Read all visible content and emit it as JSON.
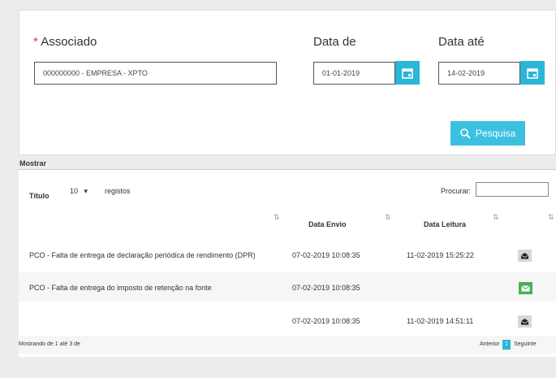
{
  "form": {
    "associado_label": "Associado",
    "required_mark": "*",
    "associado_value": "000000000 - EMPRESA - XPTO",
    "data_de_label": "Data de",
    "data_de_value": "01-01-2019",
    "data_ate_label": "Data até",
    "data_ate_value": "14-02-2019",
    "search_label": "Pesquisa"
  },
  "table": {
    "mostrar_label": "Mostrar",
    "titulo_label": "Título",
    "page_size": "10",
    "registos_label": "registos",
    "procurar_label": "Procurar:",
    "columns": [
      "Data Envio",
      "Data Leitura"
    ],
    "rows": [
      {
        "titulo": "PCO - Falta de entrega de declaração periódica de rendimento (DPR)",
        "envio": "07-02-2019 10:08:35",
        "leitura": "11-02-2019 15:25:22",
        "status": "read"
      },
      {
        "titulo": "PCO - Falta de entrega do imposto de retenção na fonte",
        "envio": "07-02-2019 10:08:35",
        "leitura": "",
        "status": "unread"
      },
      {
        "titulo": "",
        "envio": "07-02-2019 10:08:35",
        "leitura": "11-02-2019 14:51:11",
        "status": "read"
      }
    ],
    "info": "Mostrando de 1 até 3 de",
    "prev_label": "Anterior",
    "page_number": "1",
    "next_label": "Seguinte"
  },
  "colors": {
    "accent": "#29b6d9",
    "unread": "#4caf50",
    "read": "#d6d6d6"
  }
}
